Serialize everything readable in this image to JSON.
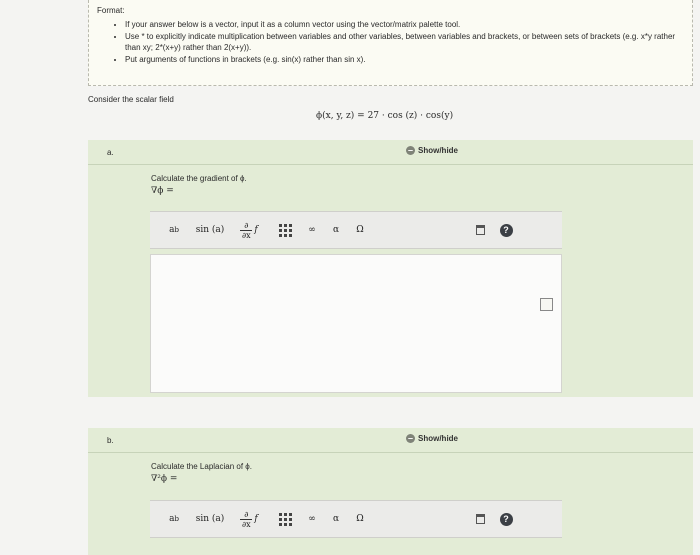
{
  "format": {
    "title": "Format:",
    "items": [
      "If your answer below is a vector, input it as a column vector using the vector/matrix palette tool.",
      "Use * to explicitly indicate multiplication between variables and other variables, between variables and brackets, or between sets of brackets (e.g. x*y rather than xy; 2*(x+y) rather than 2(x+y)).",
      "Put arguments of functions in brackets (e.g. sin(x) rather than sin x)."
    ]
  },
  "intro": "Consider the scalar field",
  "formula": "ϕ(x, y, z) = 27 · cos (z) · cos(y)",
  "part_a": {
    "letter": "a.",
    "showhide": "Show/hide",
    "question": "Calculate the gradient of ϕ.",
    "answer_label": "∇ϕ ="
  },
  "part_b": {
    "letter": "b.",
    "showhide": "Show/hide",
    "question": "Calculate the Laplacian of ϕ.",
    "answer_label": "∇²ϕ ="
  },
  "toolbar": {
    "power": "a",
    "power_sup": "b",
    "sin": "sin (a)",
    "partial_top": "∂",
    "partial_bottom": "∂x",
    "partial_f": "f",
    "infinity": "∞",
    "alpha": "α",
    "omega": "Ω",
    "help": "?"
  }
}
